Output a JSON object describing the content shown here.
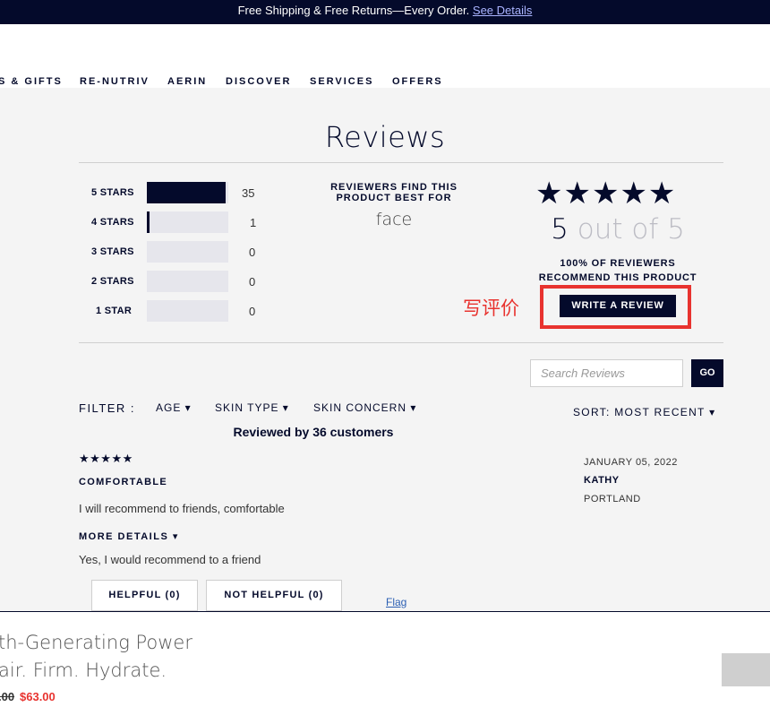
{
  "promo": {
    "text": "Free Shipping & Free Returns—Every Order.",
    "link": "See Details"
  },
  "nav": {
    "items": [
      "S & GIFTS",
      "RE-NUTRIV",
      "AERIN",
      "DISCOVER",
      "SERVICES",
      "OFFERS"
    ]
  },
  "reviews": {
    "title": "Reviews",
    "histogram": [
      {
        "label": "5 STARS",
        "count": "35",
        "fraction": 0.97
      },
      {
        "label": "4 STARS",
        "count": "1",
        "fraction": 0.03
      },
      {
        "label": "3 STARS",
        "count": "0",
        "fraction": 0
      },
      {
        "label": "2 STARS",
        "count": "0",
        "fraction": 0
      },
      {
        "label": "1 STAR",
        "count": "0",
        "fraction": 0
      }
    ],
    "best_for_heading": "REVIEWERS FIND THIS PRODUCT BEST FOR",
    "best_for_value": "face",
    "stars": "★★★★★",
    "score_number": "5",
    "score_suffix": " out of 5",
    "recommend_pct": "100%",
    "recommend_text": " OF REVIEWERS RECOMMEND THIS PRODUCT",
    "annotation": "写评价",
    "write_button": "WRITE A REVIEW",
    "search_placeholder": "Search Reviews",
    "go_button": "GO",
    "filter_label": "FILTER :",
    "filters": [
      "AGE ▾",
      "SKIN TYPE ▾",
      "SKIN CONCERN ▾"
    ],
    "sort_label": "SORT:",
    "sort_value": "MOST RECENT  ▾",
    "reviewed_by": "Reviewed by 36 customers"
  },
  "review": {
    "stars": "★★★★★",
    "title": "COMFORTABLE",
    "body": "I will recommend to friends, comfortable",
    "more_details": "MORE DETAILS  ▾",
    "recommend": "Yes, I would recommend to a friend",
    "helpful": "HELPFUL (0)",
    "not_helpful": "NOT HELPFUL (0)",
    "flag": "Flag",
    "date": "JANUARY 05, 2022",
    "name": "KATHY",
    "location": "PORTLAND"
  },
  "sticky": {
    "line1": "th-Generating Power",
    "line2": "air. Firm. Hydrate.",
    "old_price": ".00",
    "new_price": "$63.00"
  }
}
